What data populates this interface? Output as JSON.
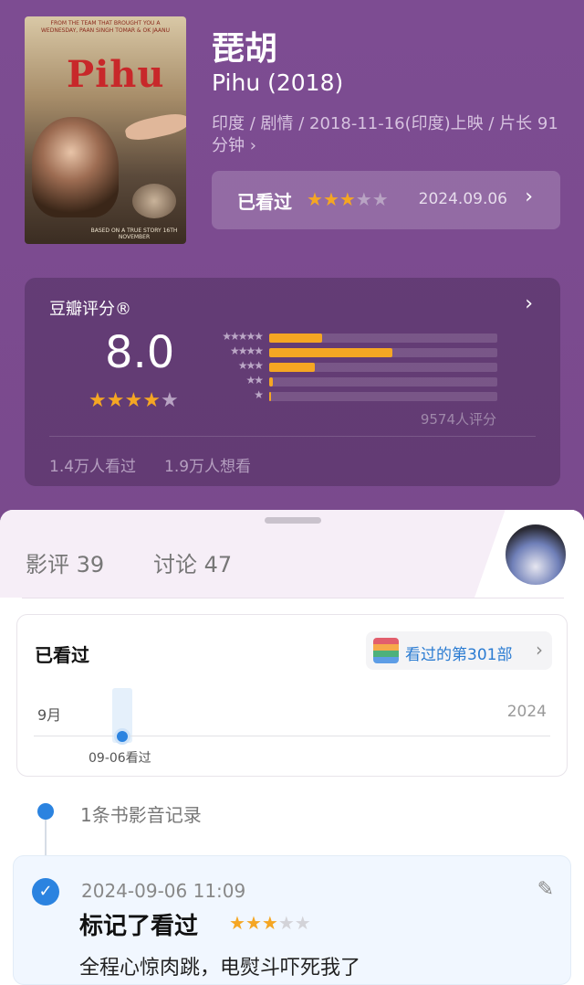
{
  "movie": {
    "title": "琵胡",
    "original_title": "Pihu (2018)",
    "meta": "印度 / 剧情 / 2018-11-16(印度)上映 / 片长 91分钟 ›",
    "poster": {
      "top_text": "FROM THE TEAM THAT BROUGHT YOU A WEDNESDAY, PAAN SINGH TOMAR & OK JAANU",
      "title_text": "Pihu",
      "bottom_text": "BASED ON A TRUE STORY 16TH NOVEMBER"
    }
  },
  "my_status": {
    "label": "已看过",
    "stars": 3,
    "date": "2024.09.06"
  },
  "rating": {
    "label": "豆瓣评分®",
    "score": "8.0",
    "stars": 4,
    "distribution": [
      {
        "stars": 5,
        "glyph": "★★★★★",
        "fraction": 0.23
      },
      {
        "stars": 4,
        "glyph": "★★★★",
        "fraction": 0.54
      },
      {
        "stars": 3,
        "glyph": "★★★",
        "fraction": 0.2
      },
      {
        "stars": 2,
        "glyph": "★★",
        "fraction": 0.016
      },
      {
        "stars": 1,
        "glyph": "★",
        "fraction": 0.006
      }
    ],
    "count": "9574人评分",
    "seen": "1.4万人看过",
    "want": "1.9万人想看"
  },
  "tabs": [
    {
      "label": "影评 39"
    },
    {
      "label": "讨论 47"
    }
  ],
  "watched_card": {
    "title": "已看过",
    "count_text": "看过的第301部",
    "month": "9月",
    "year": "2024",
    "date_label": "09-06看过"
  },
  "timeline": {
    "summary": "1条书影音记录"
  },
  "record": {
    "datetime": "2024-09-06 11:09",
    "title": "标记了看过",
    "stars": 3,
    "comment": "全程心惊肉跳，电熨斗吓死我了"
  },
  "icons": {
    "chevron": "chevron-right-icon",
    "edit": "pencil-icon",
    "check": "check-icon"
  },
  "colors": {
    "header_bg": "#7b4a8f",
    "star": "#f5a623",
    "accent_blue": "#2b83e0"
  }
}
